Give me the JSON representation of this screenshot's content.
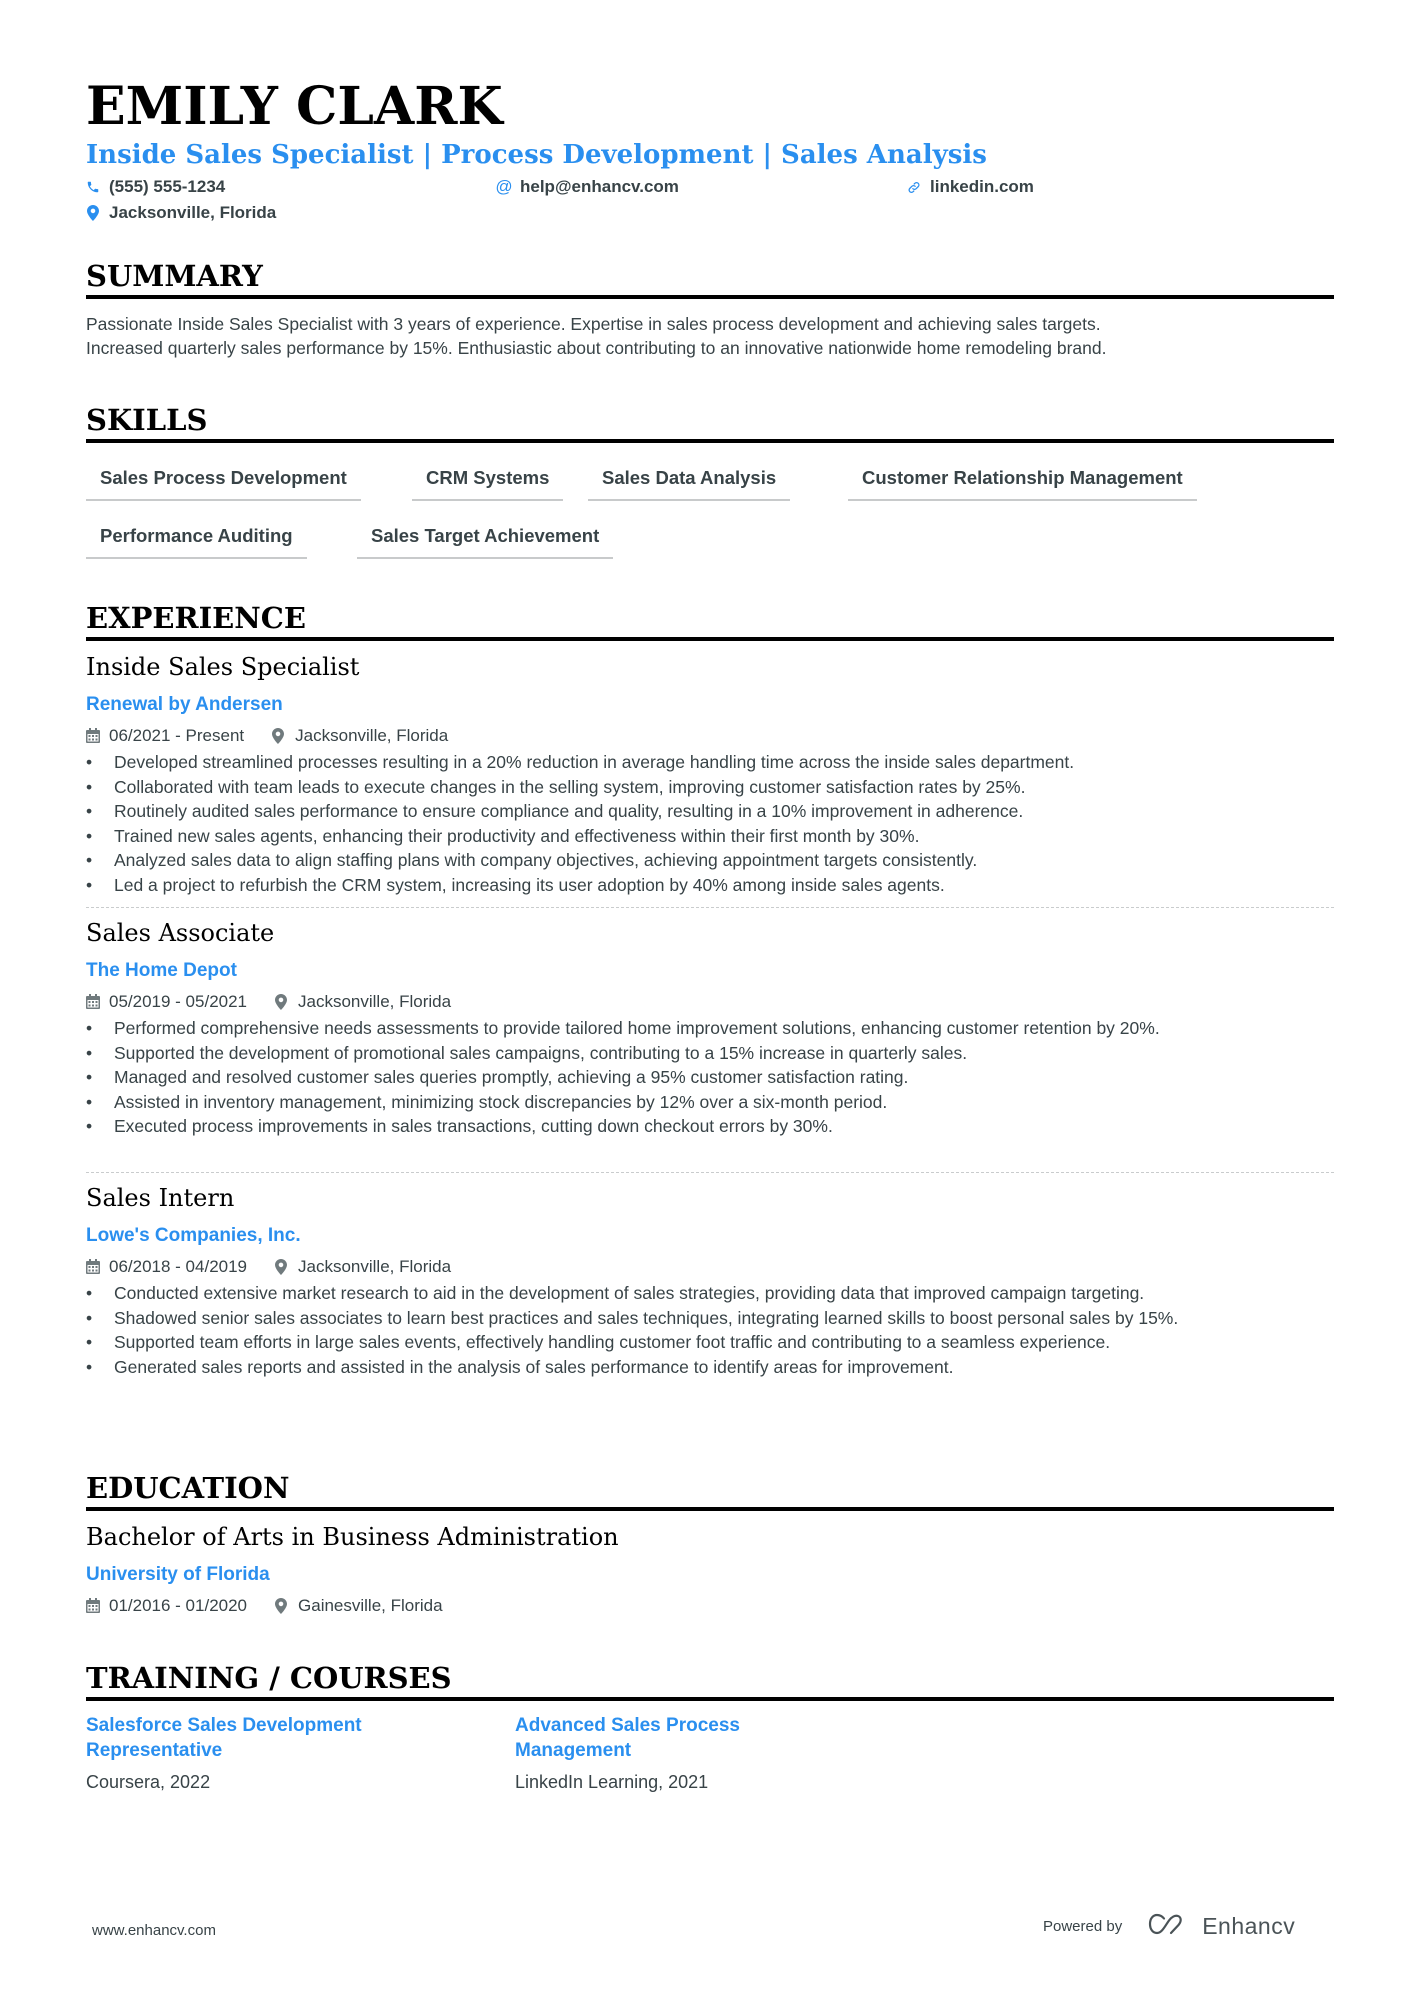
{
  "header": {
    "name": "EMILY CLARK",
    "headline": "Inside Sales Specialist | Process Development | Sales Analysis",
    "contacts": {
      "phone": "(555) 555-1234",
      "email": "help@enhancv.com",
      "linkedin": "linkedin.com",
      "location": "Jacksonville, Florida"
    }
  },
  "colors": {
    "accent": "#2a8fef",
    "text": "#384347",
    "heading": "#000000"
  },
  "summary": {
    "title": "SUMMARY",
    "lines": [
      "Passionate Inside Sales Specialist with 3 years of experience. Expertise in sales process development and achieving sales targets.",
      "Increased quarterly sales performance by 15%. Enthusiastic about contributing to an innovative nationwide home remodeling brand."
    ]
  },
  "skills": {
    "title": "SKILLS",
    "items": [
      "Sales Process Development",
      "CRM Systems",
      "Sales Data Analysis",
      "Customer Relationship Management",
      "Performance Auditing",
      "Sales Target Achievement"
    ]
  },
  "experience": {
    "title": "EXPERIENCE",
    "jobs": [
      {
        "title": "Inside Sales Specialist",
        "company": "Renewal by Andersen",
        "dates": "06/2021 - Present",
        "location": "Jacksonville, Florida",
        "bullets": [
          "Developed streamlined processes resulting in a 20% reduction in average handling time across the inside sales department.",
          "Collaborated with team leads to execute changes in the selling system, improving customer satisfaction rates by 25%.",
          "Routinely audited sales performance to ensure compliance and quality, resulting in a 10% improvement in adherence.",
          "Trained new sales agents, enhancing their productivity and effectiveness within their first month by 30%.",
          "Analyzed sales data to align staffing plans with company objectives, achieving appointment targets consistently.",
          "Led a project to refurbish the CRM system, increasing its user adoption by 40% among inside sales agents."
        ]
      },
      {
        "title": "Sales Associate",
        "company": "The Home Depot",
        "dates": "05/2019 - 05/2021",
        "location": "Jacksonville, Florida",
        "bullets": [
          "Performed comprehensive needs assessments to provide tailored home improvement solutions, enhancing customer retention by 20%.",
          "Supported the development of promotional sales campaigns, contributing to a 15% increase in quarterly sales.",
          "Managed and resolved customer sales queries promptly, achieving a 95% customer satisfaction rating.",
          "Assisted in inventory management, minimizing stock discrepancies by 12% over a six-month period.",
          "Executed process improvements in sales transactions, cutting down checkout errors by 30%."
        ]
      },
      {
        "title": "Sales Intern",
        "company": "Lowe's Companies, Inc.",
        "dates": "06/2018 - 04/2019",
        "location": "Jacksonville, Florida",
        "bullets": [
          "Conducted extensive market research to aid in the development of sales strategies, providing data that improved campaign targeting.",
          "Shadowed senior sales associates to learn best practices and sales techniques, integrating learned skills to boost personal sales by 15%.",
          "Supported team efforts in large sales events, effectively handling customer foot traffic and contributing to a seamless experience.",
          "Generated sales reports and assisted in the analysis of sales performance to identify areas for improvement."
        ]
      }
    ]
  },
  "education": {
    "title": "EDUCATION",
    "degree": "Bachelor of Arts in Business Administration",
    "school": "University of Florida",
    "dates": "01/2016 - 01/2020",
    "location": "Gainesville, Florida"
  },
  "training": {
    "title": "TRAINING / COURSES",
    "courses": [
      {
        "title": "Salesforce Sales Development Representative",
        "provider": "Coursera, 2022"
      },
      {
        "title": "Advanced Sales Process Management",
        "provider": "LinkedIn Learning, 2021"
      }
    ]
  },
  "footer": {
    "website": "www.enhancv.com",
    "powered_by": "Powered by",
    "brand": "Enhancv"
  }
}
